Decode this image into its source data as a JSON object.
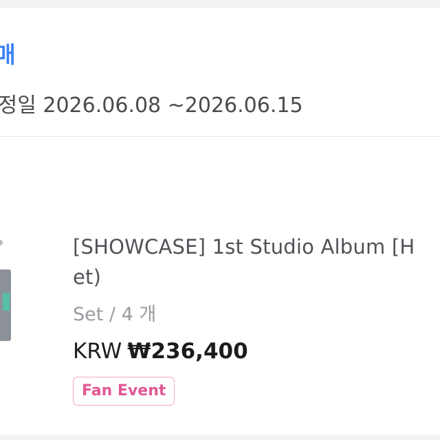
{
  "sale": {
    "status": "판매",
    "ship_date_label": "예정일",
    "ship_date_range": "2026.06.08 ~2026.06.15"
  },
  "product": {
    "title_line1": "[SHOWCASE] 1st Studio Album [H",
    "title_line2": "et)",
    "option": "Set / 4 개",
    "currency": "KRW",
    "price": "₩236,400",
    "badge": "Fan Event",
    "thumbnail_icon": "album-cover-thumbnail"
  },
  "colors": {
    "status_blue": "#3b82f6",
    "badge_pink": "#e25894",
    "badge_border": "#f3a8c7",
    "text_dark": "#1c1c1f",
    "text_muted": "#9a9aa1"
  }
}
